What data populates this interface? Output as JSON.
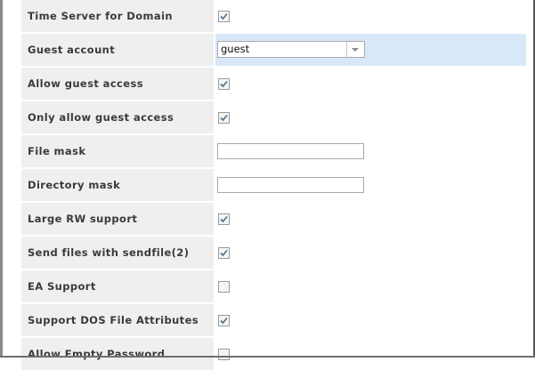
{
  "settings": [
    {
      "label": "Time Server for Domain",
      "type": "checkbox",
      "checked": true
    },
    {
      "label": "Guest account",
      "type": "select",
      "value": "guest",
      "highlighted": true
    },
    {
      "label": "Allow guest access",
      "type": "checkbox",
      "checked": true
    },
    {
      "label": "Only allow guest access",
      "type": "checkbox",
      "checked": true
    },
    {
      "label": "File mask",
      "type": "text",
      "value": ""
    },
    {
      "label": "Directory mask",
      "type": "text",
      "value": ""
    },
    {
      "label": "Large RW support",
      "type": "checkbox",
      "checked": true
    },
    {
      "label": "Send files with sendfile(2)",
      "type": "checkbox",
      "checked": true
    },
    {
      "label": "EA Support",
      "type": "checkbox",
      "checked": false
    },
    {
      "label": "Support DOS File Attributes",
      "type": "checkbox",
      "checked": true
    },
    {
      "label": "Allow Empty Password",
      "type": "checkbox",
      "checked": false
    }
  ],
  "colors": {
    "label_bg": "#efefef",
    "highlight_row": "#d8e8f8",
    "check_mark": "#4a6f8a"
  }
}
